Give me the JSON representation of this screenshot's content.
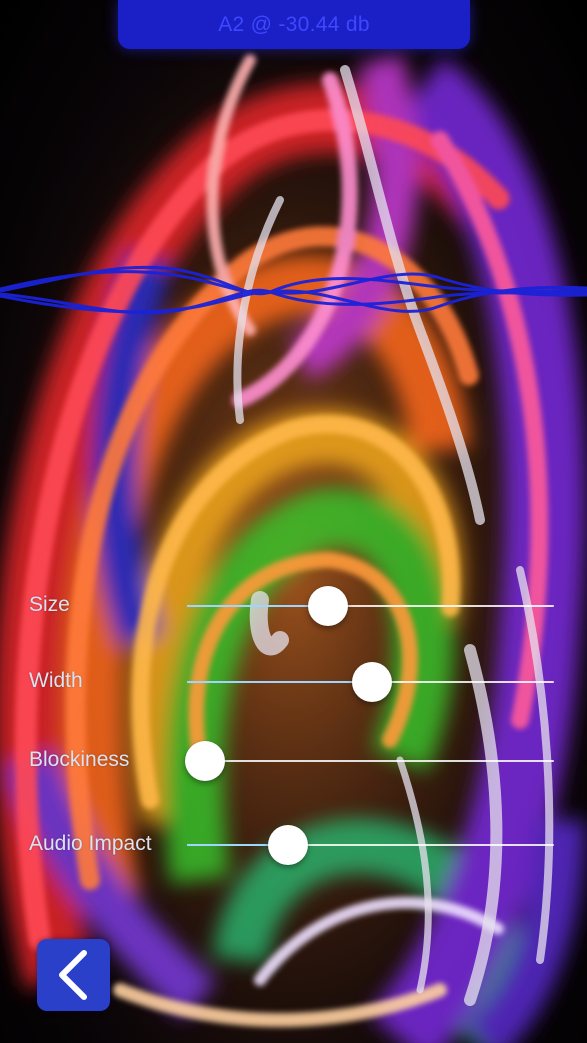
{
  "status": {
    "note_readout": "A2 @ -30.44 db"
  },
  "controls": [
    {
      "label": "Size",
      "value": 0.385
    },
    {
      "label": "Width",
      "value": 0.504
    },
    {
      "label": "Blockiness",
      "value": 0.05
    },
    {
      "label": "Audio Impact",
      "value": 0.275
    }
  ],
  "navigation": {
    "back_icon": "chevron-left-icon"
  },
  "colors": {
    "pill_bg": "#1b1fc6",
    "pill_text": "#3d48ff",
    "back_button_bg": "#2a40c8",
    "waveform": "#1a22d8",
    "slider_fill": "#9fd6ff"
  }
}
